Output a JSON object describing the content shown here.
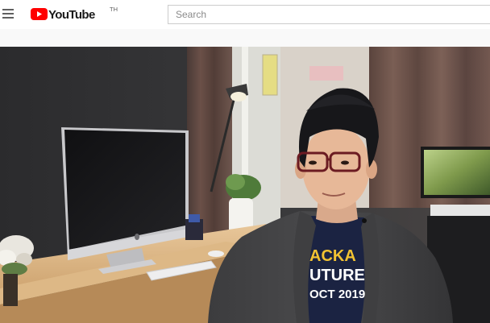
{
  "masthead": {
    "menu_icon": "hamburger-menu-icon",
    "logo": {
      "icon": "youtube-play-icon",
      "text": "YouTube",
      "country_code": "TH",
      "brand_color": "#ff0000"
    },
    "search": {
      "placeholder": "Search",
      "value": ""
    }
  },
  "player": {
    "shirt_text_lines": [
      "ACKA",
      "UTURE",
      "OCT 2019"
    ]
  }
}
